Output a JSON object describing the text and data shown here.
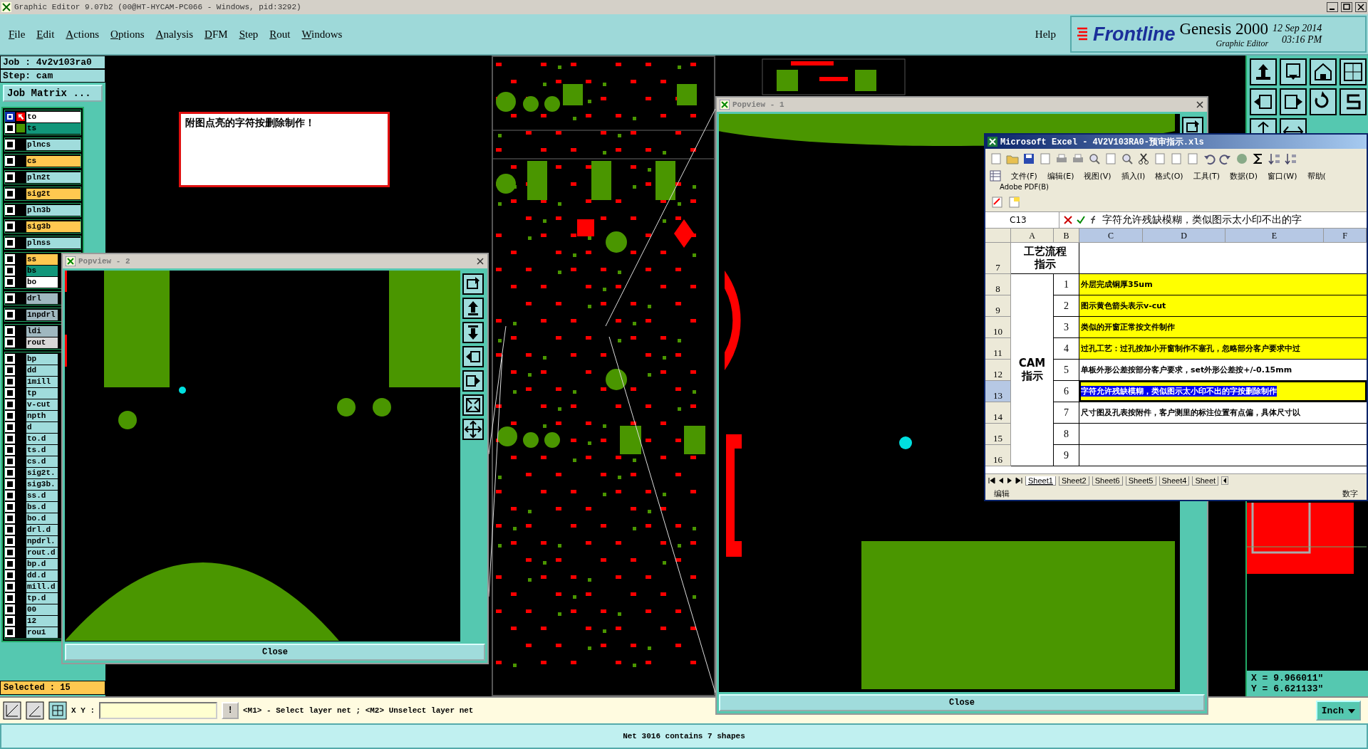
{
  "window": {
    "title": "Graphic Editor 9.07b2 (00@HT-HYCAM-PC066 - Windows, pid:3292)"
  },
  "menu": [
    "File",
    "Edit",
    "Actions",
    "Options",
    "Analysis",
    "DFM",
    "Step",
    "Rout",
    "Windows"
  ],
  "help": "Help",
  "brand": {
    "logo": "Frontline",
    "product": "Genesis 2000",
    "subtitle": "Graphic Editor",
    "date": "12 Sep 2014",
    "time": "03:16 PM"
  },
  "job": {
    "job": "Job : 4v2v103ra0",
    "step": "Step: cam",
    "matrix_button": "Job Matrix ..."
  },
  "layer_groups": [
    {
      "layers": [
        {
          "name": "to",
          "color": "#ffffff",
          "work": true,
          "displayed": false
        },
        {
          "name": "ts",
          "color": "#12967a",
          "work": false,
          "displayed": true
        }
      ]
    },
    {
      "layers": [
        {
          "name": "plncs",
          "color": "#a0dcdc",
          "work": false,
          "displayed": false
        }
      ]
    },
    {
      "layers": [
        {
          "name": "cs",
          "color": "#ffc850",
          "work": false,
          "displayed": false
        }
      ]
    },
    {
      "layers": [
        {
          "name": "pln2t",
          "color": "#a0dcdc",
          "work": false,
          "displayed": false
        }
      ]
    },
    {
      "layers": [
        {
          "name": "sig2t",
          "color": "#ffc850",
          "work": false,
          "displayed": false
        }
      ]
    },
    {
      "layers": [
        {
          "name": "pln3b",
          "color": "#a0dcdc",
          "work": false,
          "displayed": false
        }
      ]
    },
    {
      "layers": [
        {
          "name": "sig3b",
          "color": "#ffc850",
          "work": false,
          "displayed": false
        }
      ]
    },
    {
      "layers": [
        {
          "name": "plnss",
          "color": "#a0dcdc",
          "work": false,
          "displayed": false
        }
      ]
    },
    {
      "layers": [
        {
          "name": "ss",
          "color": "#ffc850",
          "work": false,
          "displayed": false
        },
        {
          "name": "bs",
          "color": "#12967a",
          "work": false,
          "displayed": false
        },
        {
          "name": "bo",
          "color": "#ffffff",
          "work": false,
          "displayed": false
        }
      ]
    },
    {
      "layers": [
        {
          "name": "drl",
          "color": "#a0b8c0",
          "work": false,
          "displayed": false
        }
      ]
    },
    {
      "layers": [
        {
          "name": "1npdrl",
          "color": "#a0b8c0",
          "work": false,
          "displayed": false
        }
      ]
    },
    {
      "layers": [
        {
          "name": "ldi",
          "color": "#a0b8c0",
          "work": false,
          "displayed": false
        },
        {
          "name": "rout",
          "color": "#d8d8d8",
          "work": false,
          "displayed": false
        }
      ]
    },
    {
      "layers": [
        {
          "name": "bp",
          "color": "#a0dcdc",
          "work": false,
          "displayed": false
        },
        {
          "name": "dd",
          "color": "#a0dcdc",
          "work": false,
          "displayed": false
        },
        {
          "name": "1mill",
          "color": "#a0dcdc",
          "work": false,
          "displayed": false
        },
        {
          "name": "tp",
          "color": "#a0dcdc",
          "work": false,
          "displayed": false
        },
        {
          "name": "v-cut",
          "color": "#a0dcdc",
          "work": false,
          "displayed": false
        },
        {
          "name": "npth",
          "color": "#a0dcdc",
          "work": false,
          "displayed": false
        },
        {
          "name": "d",
          "color": "#a0dcdc",
          "work": false,
          "displayed": false
        },
        {
          "name": "to.d",
          "color": "#a0dcdc",
          "work": false,
          "displayed": false
        },
        {
          "name": "ts.d",
          "color": "#a0dcdc",
          "work": false,
          "displayed": false
        },
        {
          "name": "cs.d",
          "color": "#a0dcdc",
          "work": false,
          "displayed": false
        },
        {
          "name": "sig2t.",
          "color": "#a0dcdc",
          "work": false,
          "displayed": false
        },
        {
          "name": "sig3b.",
          "color": "#a0dcdc",
          "work": false,
          "displayed": false
        },
        {
          "name": "ss.d",
          "color": "#a0dcdc",
          "work": false,
          "displayed": false
        },
        {
          "name": "bs.d",
          "color": "#a0dcdc",
          "work": false,
          "displayed": false
        },
        {
          "name": "bo.d",
          "color": "#a0dcdc",
          "work": false,
          "displayed": false
        },
        {
          "name": "drl.d",
          "color": "#a0dcdc",
          "work": false,
          "displayed": false
        },
        {
          "name": "npdrl.",
          "color": "#a0dcdc",
          "work": false,
          "displayed": false
        },
        {
          "name": "rout.d",
          "color": "#a0dcdc",
          "work": false,
          "displayed": false
        },
        {
          "name": "bp.d",
          "color": "#a0dcdc",
          "work": false,
          "displayed": false
        },
        {
          "name": "dd.d",
          "color": "#a0dcdc",
          "work": false,
          "displayed": false
        },
        {
          "name": "mill.d",
          "color": "#a0dcdc",
          "work": false,
          "displayed": false
        },
        {
          "name": "tp.d",
          "color": "#a0dcdc",
          "work": false,
          "displayed": false
        },
        {
          "name": "00",
          "color": "#a0dcdc",
          "work": false,
          "displayed": false
        },
        {
          "name": "12",
          "color": "#a0dcdc",
          "work": false,
          "displayed": false
        },
        {
          "name": "rou1",
          "color": "#a0dcdc",
          "work": false,
          "displayed": false
        }
      ]
    }
  ],
  "selected_count": "Selected : 15",
  "note": "附图点亮的字符按删除制作！",
  "popviews": [
    {
      "title": "Popview - 2",
      "close": "Close"
    },
    {
      "title": "Popview - 1",
      "close": "Close"
    }
  ],
  "excel": {
    "title": "Microsoft Excel - 4V2V103RA0-预审指示.xls",
    "menus": [
      "文件(F)",
      "编辑(E)",
      "视图(V)",
      "插入(I)",
      "格式(O)",
      "工具(T)",
      "数据(D)",
      "窗口(W)",
      "帮助("
    ],
    "menu_extra": "Adobe PDF(B)",
    "name_box": "C13",
    "formula": "字符允许残缺模糊，类似图示太小印不出的字",
    "columns": [
      "A",
      "B",
      "C",
      "D",
      "E",
      "F"
    ],
    "row_numbers": [
      {
        "label": "7",
        "selected": false
      },
      {
        "label": "8",
        "selected": false
      },
      {
        "label": "9",
        "selected": false
      },
      {
        "label": "10",
        "selected": false
      },
      {
        "label": "11",
        "selected": false
      },
      {
        "label": "12",
        "selected": false
      },
      {
        "label": "13",
        "selected": true
      },
      {
        "label": "14",
        "selected": false
      },
      {
        "label": "15",
        "selected": false
      },
      {
        "label": "16",
        "selected": false
      }
    ],
    "section_titles": [
      {
        "lines": [
          "工艺流程",
          "指示"
        ]
      },
      {
        "lines": [
          "CAM",
          "指示"
        ]
      }
    ],
    "items": [
      {
        "number": "1",
        "text": "外层完成铜厚35um",
        "color": "#ffff00",
        "selected": false
      },
      {
        "number": "2",
        "text": "图示黄色箭头表示v-cut",
        "color": "#ffff00",
        "selected": false
      },
      {
        "number": "3",
        "text": "类似的开窗正常按文件制作",
        "color": "#ffff00",
        "selected": false
      },
      {
        "number": "4",
        "text": "过孔工艺：过孔按加小开窗制作不塞孔，忽略部分客户要求中过",
        "color": "#ffff00",
        "selected": false
      },
      {
        "number": "5",
        "text": "单板外形公差按部分客户要求，set外形公差按+/-0.15mm",
        "color": "#ffffff",
        "selected": false
      },
      {
        "number": "6",
        "text": "字符允许残缺模糊，类似图示太小印不出的字按删除制作",
        "color": "#ffff00",
        "selected": true
      },
      {
        "number": "7",
        "text": "尺寸图及孔表按附件，客户测里的标注位置有点偏，具体尺寸以",
        "color": "#ffffff",
        "selected": false
      },
      {
        "number": "8",
        "color": "#ffffff",
        "selected": false
      },
      {
        "number": "9",
        "color": "#ffffff",
        "selected": false
      }
    ],
    "sheets": [
      {
        "label": "Sheet1",
        "selected": true
      },
      {
        "label": "Sheet2",
        "selected": false
      },
      {
        "label": "Sheet6",
        "selected": false
      },
      {
        "label": "Sheet5",
        "selected": false
      },
      {
        "label": "Sheet4",
        "selected": false
      },
      {
        "label": "Sheet",
        "selected": false
      }
    ],
    "status_left": "编辑",
    "status_right": "数字"
  },
  "coords": {
    "x": "X = 9.966011\"",
    "y": "Y = 6.621133\""
  },
  "command_bar": {
    "label": "X Y :",
    "button": "!",
    "hint": "<M1> - Select layer net ; <M2> Unselect layer net",
    "units": "Inch"
  },
  "status_bar": "Net 3016 contains 7 shapes"
}
